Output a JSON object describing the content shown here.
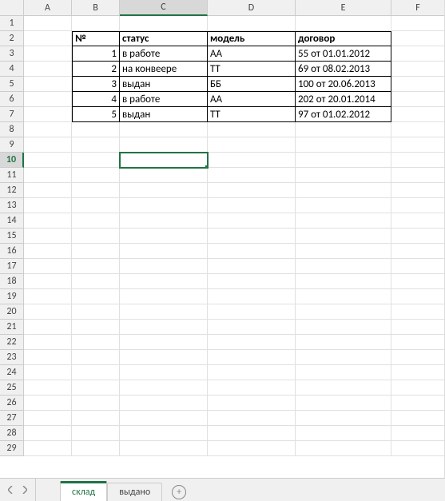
{
  "columns": [
    "A",
    "B",
    "C",
    "D",
    "E",
    "F"
  ],
  "activeColumn": "C",
  "activeRow": 10,
  "rowCount": 29,
  "headers": {
    "B": "№",
    "C": "статус",
    "D": "модель",
    "E": "договор"
  },
  "data": [
    {
      "n": "1",
      "status": "в работе",
      "model": "АА",
      "contract": "55 от 01.01.2012"
    },
    {
      "n": "2",
      "status": "на конвеере",
      "model": "ТТ",
      "contract": "69 от 08.02.2013"
    },
    {
      "n": "3",
      "status": "выдан",
      "model": "ББ",
      "contract": "100 от 20.06.2013"
    },
    {
      "n": "4",
      "status": "в работе",
      "model": "АА",
      "contract": "202 от 20.01.2014"
    },
    {
      "n": "5",
      "status": "выдан",
      "model": "ТТ",
      "contract": "97 от 01.02.2012"
    }
  ],
  "tabs": {
    "active": "склад",
    "other": "выдано"
  }
}
